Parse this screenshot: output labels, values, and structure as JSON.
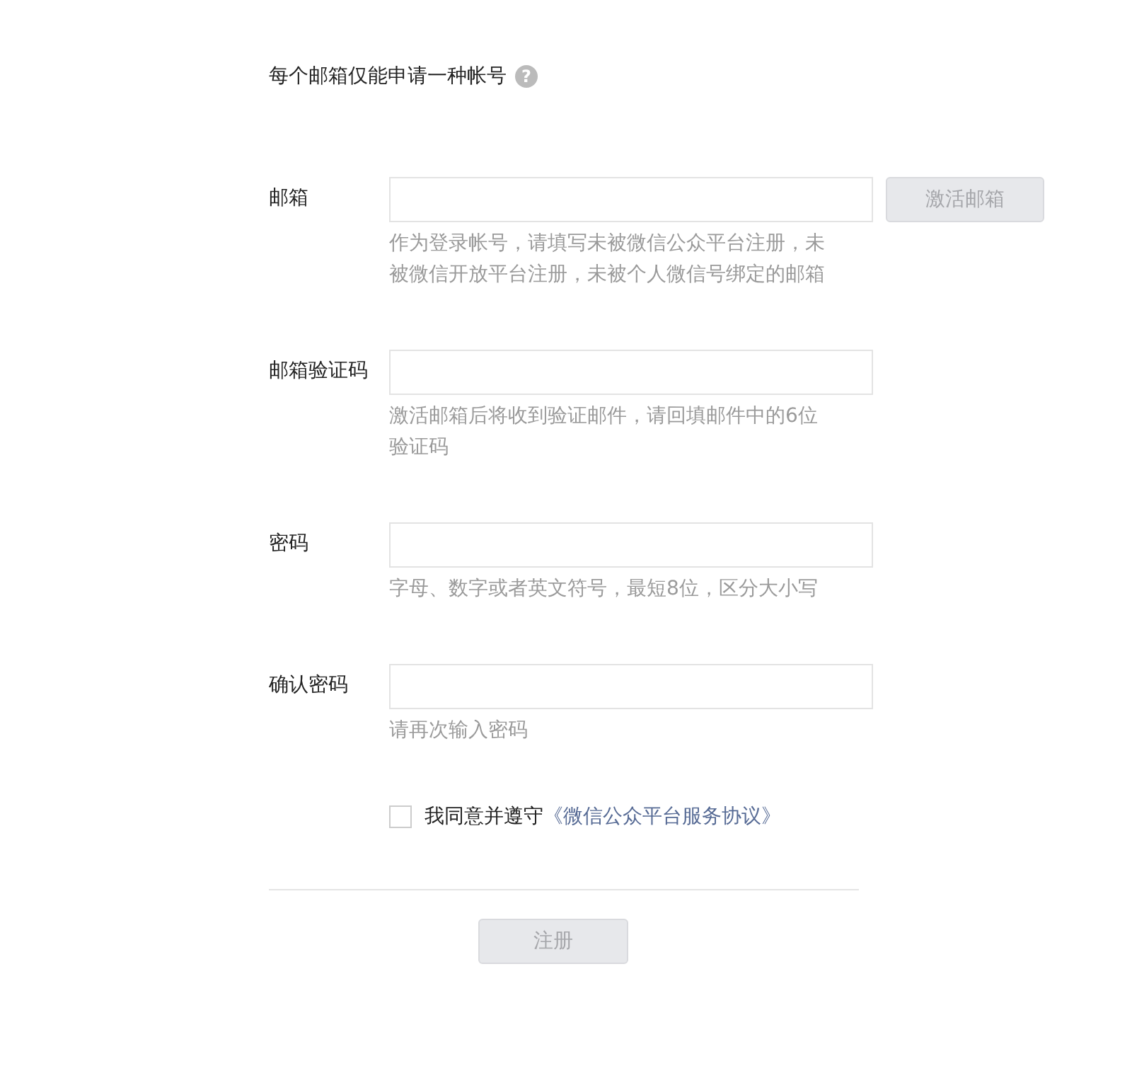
{
  "notice": {
    "text": "每个邮箱仅能申请一种帐号",
    "help_icon": "?"
  },
  "fields": [
    {
      "label": "邮箱",
      "hint": "作为登录帐号，请填写未被微信公众平台注册，未被微信开放平台注册，未被个人微信号绑定的邮箱",
      "button": {
        "label": "激活邮箱",
        "disabled": true
      }
    },
    {
      "label": "邮箱验证码",
      "hint": "激活邮箱后将收到验证邮件，请回填邮件中的6位验证码"
    },
    {
      "label": "密码",
      "hint": "字母、数字或者英文符号，最短8位，区分大小写"
    },
    {
      "label": "确认密码",
      "hint": "请再次输入密码"
    }
  ],
  "agreement": {
    "checked": false,
    "text": "我同意并遵守",
    "link": "《微信公众平台服务协议》"
  },
  "submit": {
    "label": "注册",
    "disabled": true
  }
}
